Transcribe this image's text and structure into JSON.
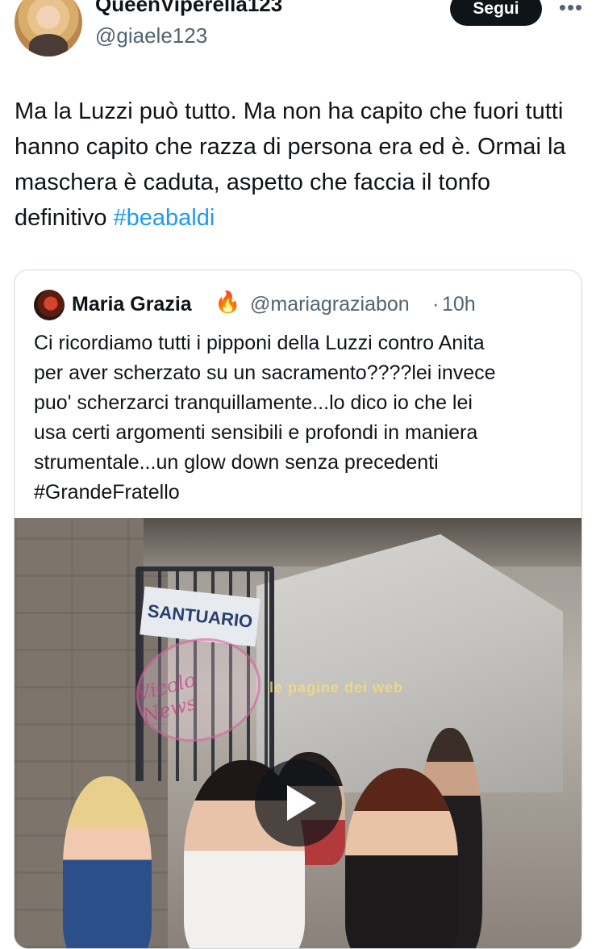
{
  "tweet": {
    "display_name": "QueenViperella123",
    "handle": "@giaele123",
    "follow_label": "Segui",
    "more_icon": "more-icon",
    "text": "Ma la Luzzi può tutto. Ma non ha capito che fuori tutti hanno capito che razza di persona era ed è. Ormai la maschera è caduta, aspetto che faccia il tonfo definitivo ",
    "hashtag": "#beabaldi"
  },
  "quote": {
    "display_name": "Maria Grazia",
    "emoji": "🔥",
    "handle": "@mariagraziabon",
    "separator": "·",
    "time": "10h",
    "text_lines": [
      "Ci ricordiamo tutti i pipponi della Luzzi contro Anita",
      "per aver scherzato su un sacramento????lei invece",
      "puo' scherzarci tranquillamente...lo dico io che lei",
      "usa certi argomenti sensibili e profondi in maniera",
      "strumentale...un glow down senza precedenti",
      "#GrandeFratello"
    ],
    "video": {
      "sign_text": "SANTUARIO",
      "watermark_text": "Vicolo News",
      "watermark2_text": "le pagine dei web",
      "play_icon": "play-icon"
    }
  },
  "colors": {
    "link": "#1d9bf0",
    "secondary_text": "#536471",
    "follow_button": "#0f1419",
    "border": "#cfd9de"
  }
}
